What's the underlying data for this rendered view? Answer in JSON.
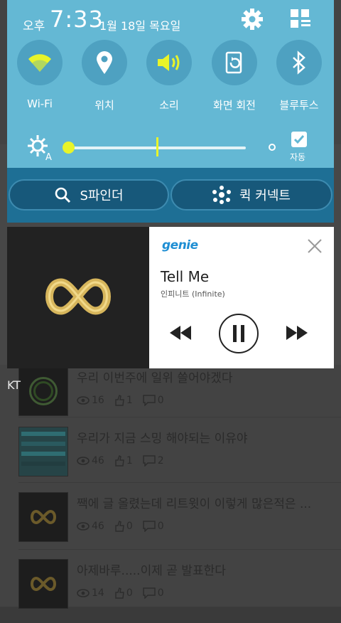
{
  "status": {
    "ampm": "오후",
    "time": "7:33",
    "date": "1월 18일 목요일"
  },
  "quick_settings": [
    {
      "label": "Wi-Fi",
      "icon": "wifi-icon",
      "active": true
    },
    {
      "label": "위치",
      "icon": "location-icon",
      "active": false
    },
    {
      "label": "소리",
      "icon": "sound-icon",
      "active": true
    },
    {
      "label": "화면 회전",
      "icon": "rotation-icon",
      "active": false
    },
    {
      "label": "블루투스",
      "icon": "bluetooth-icon",
      "active": false
    }
  ],
  "brightness": {
    "auto_label": "자동",
    "auto_checked": true,
    "level": 0.0
  },
  "shade_buttons": {
    "finder": "S파인더",
    "quick_connect": "퀵 커넥트"
  },
  "media": {
    "app": "genie",
    "title": "Tell Me",
    "artist": "인피니트 (Infinite)"
  },
  "carrier": "KT",
  "feed": [
    {
      "title": "우리 이번주에 일위 쓸어야겠다",
      "views": "16",
      "likes": "1",
      "comments": "0"
    },
    {
      "title": "우리가 지금 스밍 해야되는 이유야",
      "views": "46",
      "likes": "1",
      "comments": "2"
    },
    {
      "title": "짹에 글 올렸는데 리트윗이 이렇게 많은적은 ...",
      "views": "46",
      "likes": "0",
      "comments": "0"
    },
    {
      "title": "아제바루.....이제 곧 발표한다",
      "views": "14",
      "likes": "0",
      "comments": "0"
    }
  ],
  "colors": {
    "shade_top": "#64b8d4",
    "shade_bottom": "#1e6f95",
    "accent_active": "#e8f42a"
  }
}
